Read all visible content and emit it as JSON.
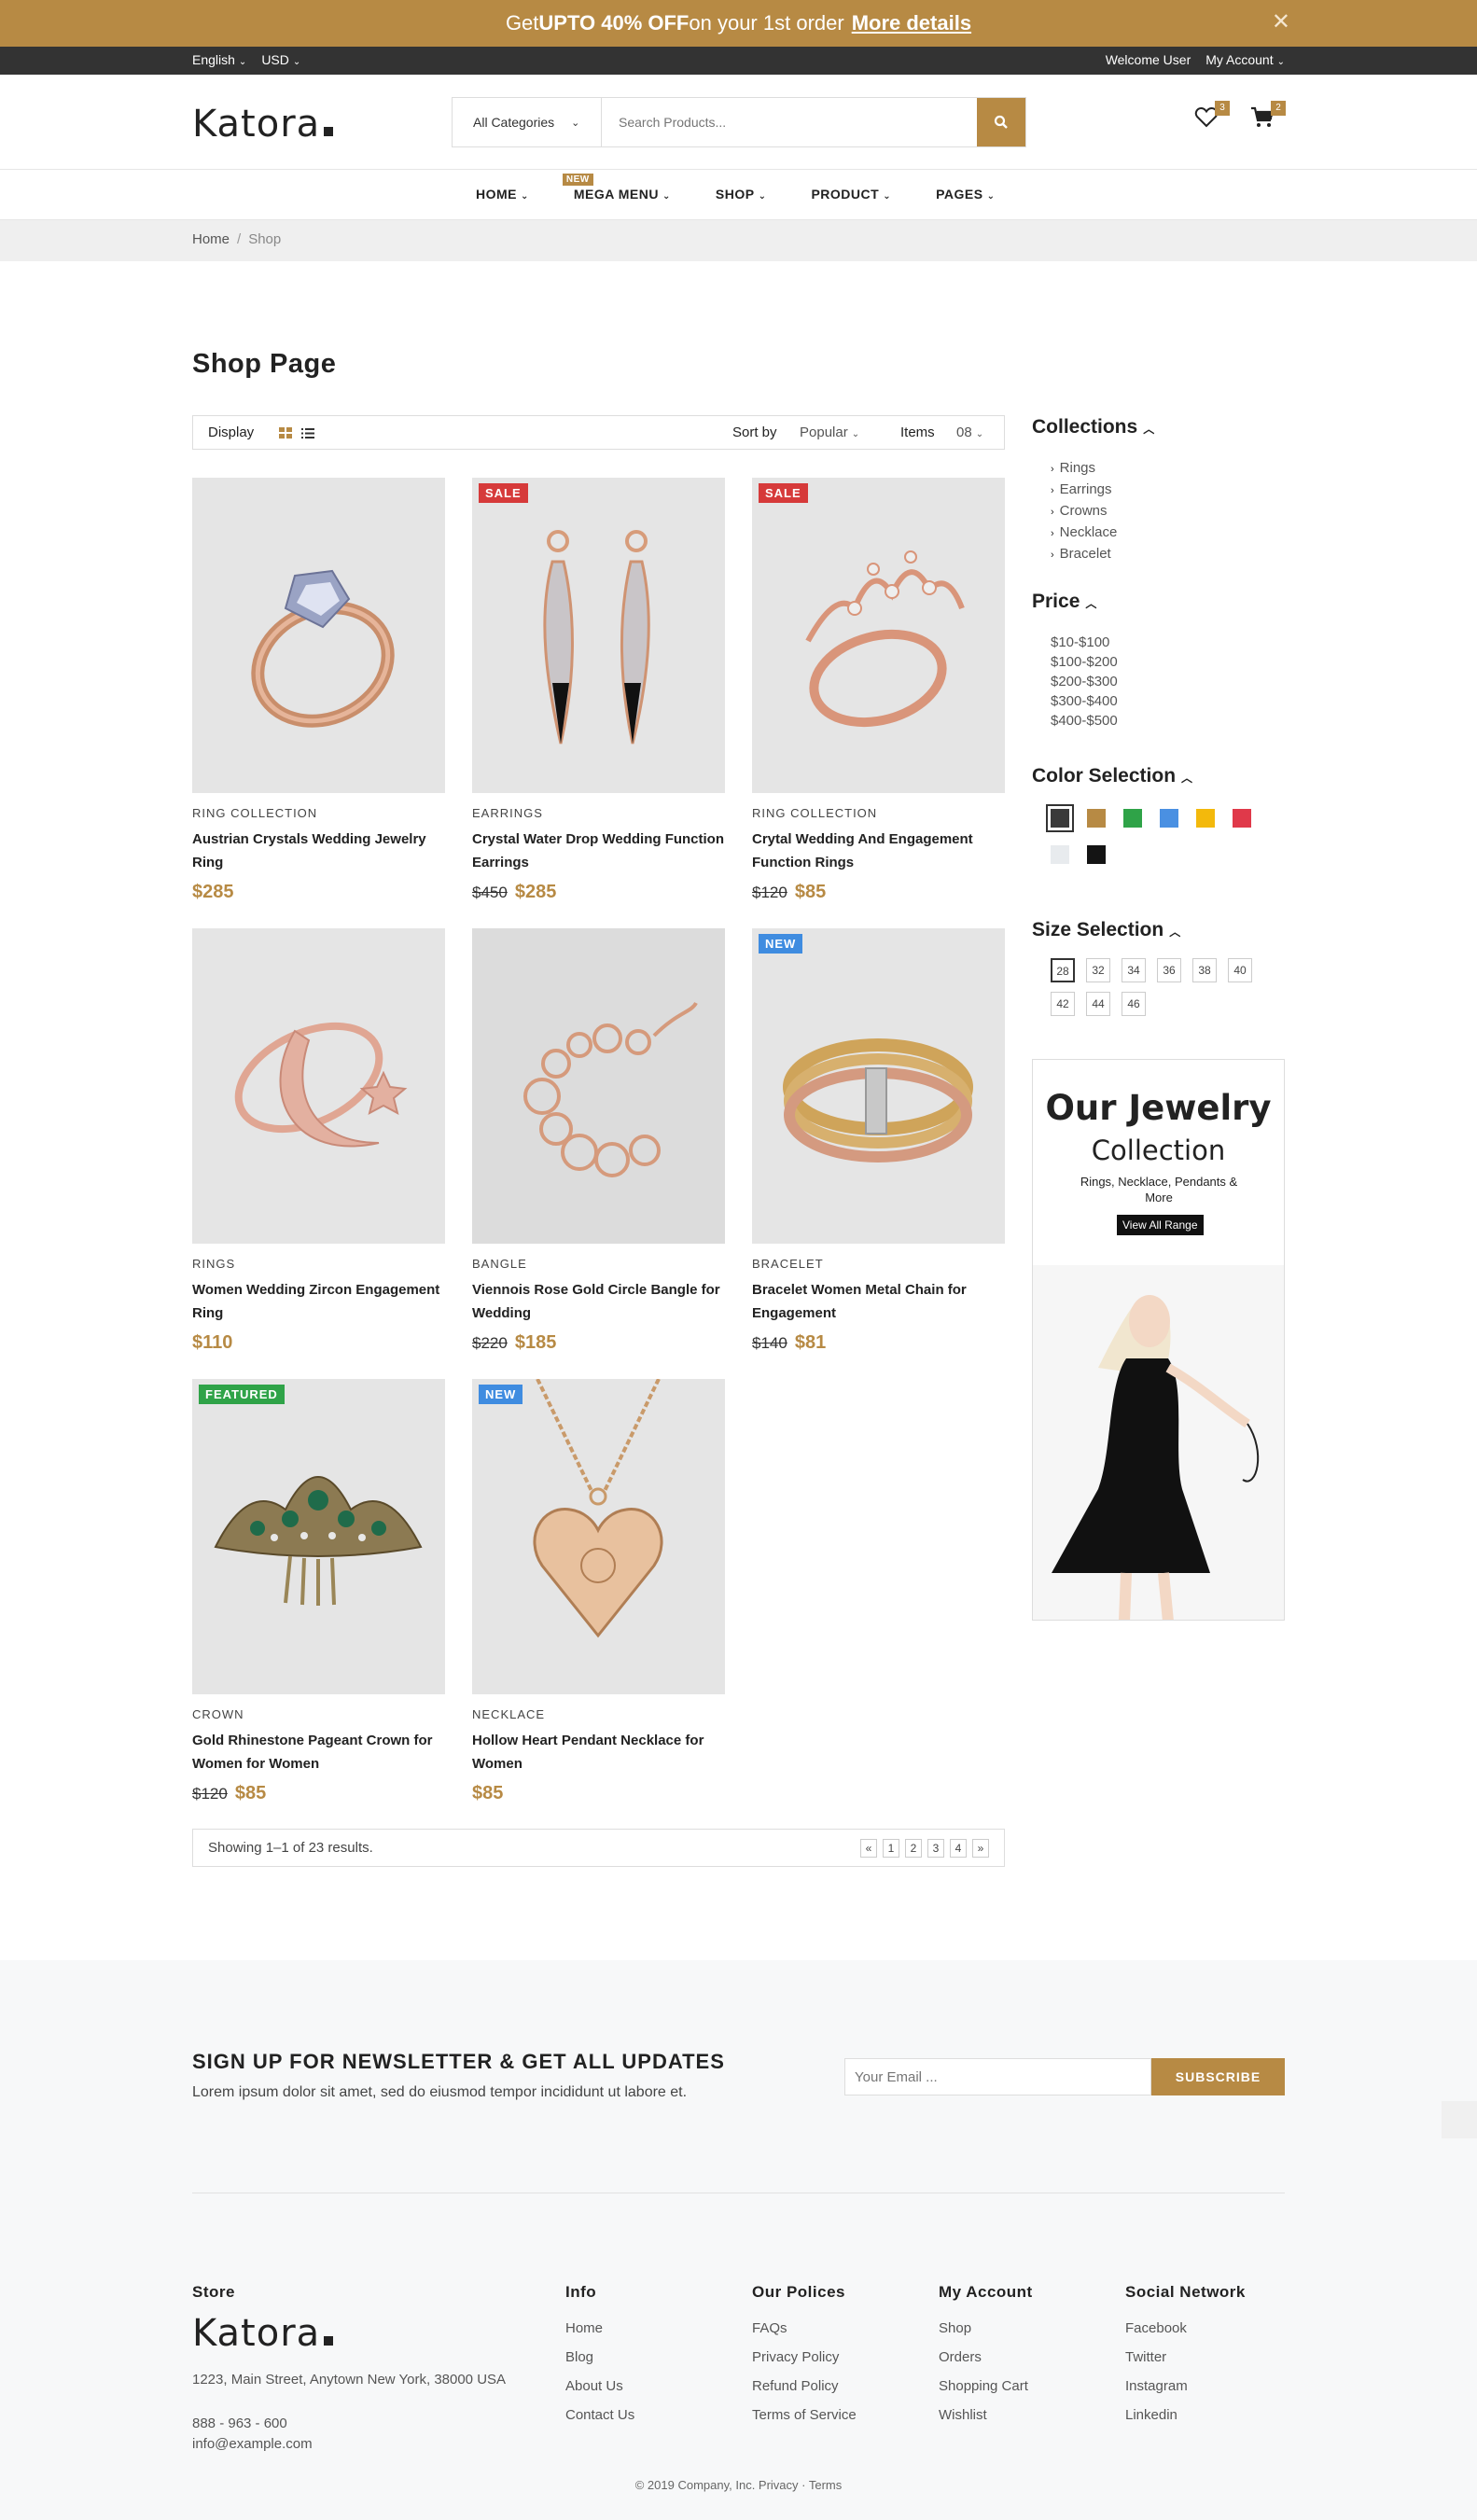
{
  "promo": {
    "pre": "Get ",
    "bold": "UPTO 40% OFF",
    "post": " on your 1st order",
    "link": "More details"
  },
  "topbar": {
    "language": "English",
    "currency": "USD",
    "welcome": "Welcome User",
    "account": "My Account"
  },
  "header": {
    "logo": "Katora",
    "category": "All Categories",
    "search_placeholder": "Search Products...",
    "wishlist_count": "3",
    "cart_count": "2"
  },
  "nav": [
    {
      "label": "HOME"
    },
    {
      "label": "MEGA MENU",
      "badge": "NEW"
    },
    {
      "label": "SHOP"
    },
    {
      "label": "PRODUCT"
    },
    {
      "label": "PAGES"
    }
  ],
  "breadcrumb": {
    "home": "Home",
    "current": "Shop"
  },
  "page_title": "Shop Page",
  "toolbar": {
    "display": "Display",
    "sort_label": "Sort by",
    "sort_value": "Popular",
    "items_label": "Items",
    "items_value": "08"
  },
  "products": [
    {
      "category": "RING COLLECTION",
      "name": "Austrian Crystals Wedding Jewelry Ring",
      "old_price": "",
      "price": "$285",
      "tag": ""
    },
    {
      "category": "EARRINGS",
      "name": "Crystal Water Drop Wedding Function Earrings",
      "old_price": "$450",
      "price": "$285",
      "tag": "SALE"
    },
    {
      "category": "RING COLLECTION",
      "name": "Crytal Wedding And Engagement Function Rings",
      "old_price": "$120",
      "price": "$85",
      "tag": "SALE"
    },
    {
      "category": "RINGS",
      "name": "Women Wedding Zircon Engagement Ring",
      "old_price": "",
      "price": "$110",
      "tag": ""
    },
    {
      "category": "BANGLE",
      "name": "Viennois Rose Gold Circle Bangle for Wedding",
      "old_price": "$220",
      "price": "$185",
      "tag": ""
    },
    {
      "category": "BRACELET",
      "name": "Bracelet Women Metal Chain for Engagement",
      "old_price": "$140",
      "price": "$81",
      "tag": "NEW"
    },
    {
      "category": "CROWN",
      "name": "Gold Rhinestone Pageant Crown for Women for Women",
      "old_price": "$120",
      "price": "$85",
      "tag": "FEATURED"
    },
    {
      "category": "NECKLACE",
      "name": "Hollow Heart Pendant Necklace for Women",
      "old_price": "",
      "price": "$85",
      "tag": "NEW"
    }
  ],
  "pagination": {
    "text": "Showing 1–1 of 23 results.",
    "prev": "«",
    "pages": [
      "1",
      "2",
      "3",
      "4"
    ],
    "next": "»"
  },
  "sidebar": {
    "collections_title": "Collections",
    "collections": [
      "Rings",
      "Earrings",
      "Crowns",
      "Necklace",
      "Bracelet"
    ],
    "price_title": "Price",
    "prices": [
      "$10-$100",
      "$100-$200",
      "$200-$300",
      "$300-$400",
      "$400-$500"
    ],
    "color_title": "Color Selection",
    "colors": [
      "#3a3a3a",
      "#b78a44",
      "#2fa348",
      "#4a90e2",
      "#f3b90c",
      "#e0394a",
      "#e8ebee",
      "#141414"
    ],
    "size_title": "Size Selection",
    "sizes": [
      "28",
      "32",
      "34",
      "36",
      "38",
      "40",
      "42",
      "44",
      "46"
    ],
    "banner": {
      "title": "Our Jewelry",
      "subtitle": "Collection",
      "text": "Rings, Necklace, Pendants & More",
      "button": "View All Range"
    }
  },
  "newsletter": {
    "title": "SIGN UP FOR NEWSLETTER & GET ALL UPDATES",
    "text": "Lorem ipsum dolor sit amet, sed do eiusmod tempor incididunt ut labore et.",
    "placeholder": "Your Email ...",
    "button": "SUBSCRIBE"
  },
  "footer": {
    "store": {
      "title": "Store",
      "logo": "Katora",
      "address": "1223, Main Street, Anytown New York, 38000 USA",
      "phone": "888 - 963 - 600",
      "email": "info@example.com"
    },
    "columns": [
      {
        "title": "Info",
        "links": [
          "Home",
          "Blog",
          "About Us",
          "Contact Us"
        ]
      },
      {
        "title": "Our Polices",
        "links": [
          "FAQs",
          "Privacy Policy",
          "Refund Policy",
          "Terms of Service"
        ]
      },
      {
        "title": "My Account",
        "links": [
          "Shop",
          "Orders",
          "Shopping Cart",
          "Wishlist"
        ]
      },
      {
        "title": "Social Network",
        "links": [
          "Facebook",
          "Twitter",
          "Instagram",
          "Linkedin"
        ]
      }
    ],
    "copyright": "© 2019 Company, Inc. Privacy · Terms"
  }
}
